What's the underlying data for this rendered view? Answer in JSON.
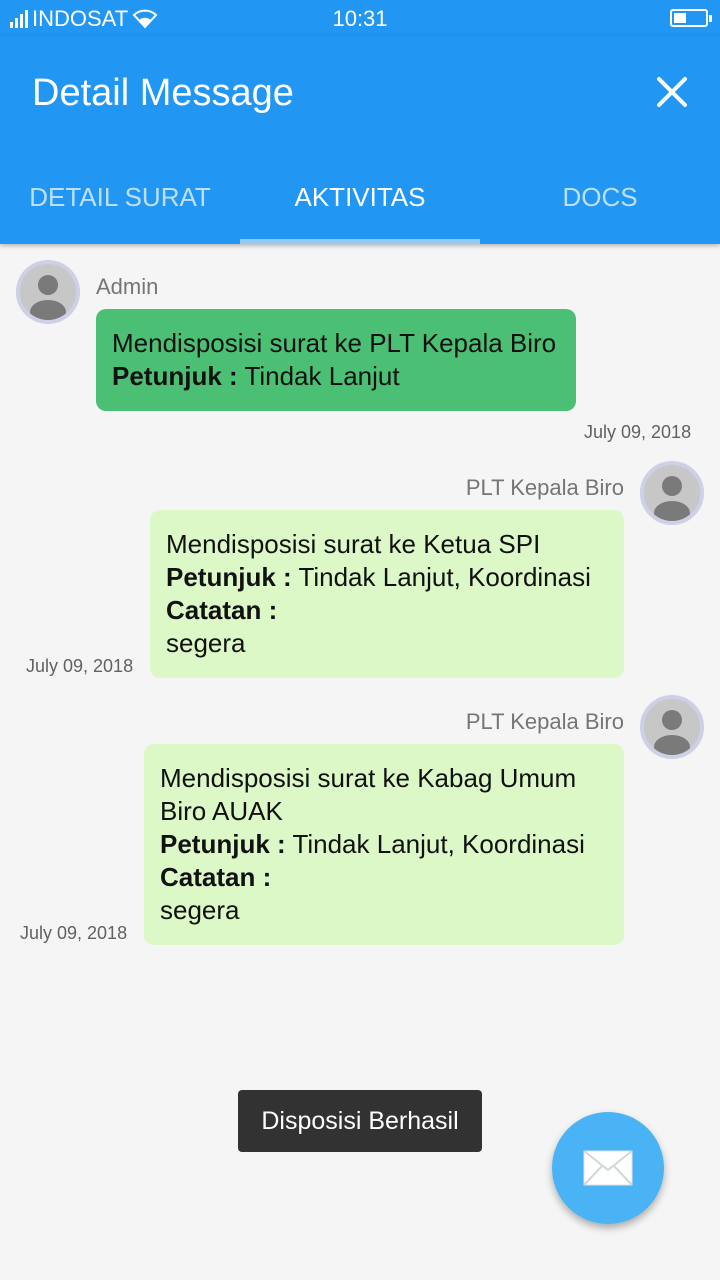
{
  "status_bar": {
    "carrier": "INDOSAT",
    "time": "10:31"
  },
  "header": {
    "title": "Detail Message",
    "close_icon": "close-icon"
  },
  "tabs": [
    {
      "label": "DETAIL SURAT",
      "active": false
    },
    {
      "label": "AKTIVITAS",
      "active": true
    },
    {
      "label": "DOCS",
      "active": false
    }
  ],
  "messages": [
    {
      "sender": "Admin",
      "text": "Mendisposisi surat ke PLT Kepala Biro",
      "petunjuk_label": "Petunjuk :",
      "petunjuk": "Tindak Lanjut",
      "date": "July 09, 2018",
      "color": "#4bbf73"
    },
    {
      "sender": "PLT Kepala Biro",
      "text": "Mendisposisi surat ke Ketua SPI",
      "petunjuk_label": "Petunjuk :",
      "petunjuk": "Tindak Lanjut, Koordinasi",
      "catatan_label": "Catatan :",
      "catatan": "segera",
      "date": "July 09, 2018",
      "color": "#dcf8c6"
    },
    {
      "sender": "PLT Kepala Biro",
      "text": "Mendisposisi surat ke Kabag Umum Biro AUAK",
      "petunjuk_label": "Petunjuk :",
      "petunjuk": "Tindak Lanjut, Koordinasi",
      "catatan_label": "Catatan :",
      "catatan": "segera",
      "date": "July 09, 2018",
      "color": "#dcf8c6"
    }
  ],
  "toast": "Disposisi Berhasil",
  "fab": {
    "icon": "envelope-icon"
  }
}
